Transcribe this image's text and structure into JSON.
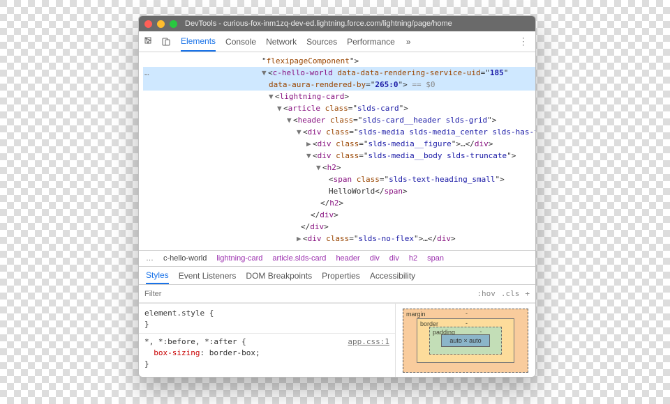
{
  "title": "DevTools - curious-fox-inm1zq-dev-ed.lightning.force.com/lightning/page/home",
  "tabs": [
    "Elements",
    "Console",
    "Network",
    "Sources",
    "Performance"
  ],
  "tabs_more": "»",
  "breadcrumbs": {
    "ell": "…",
    "cur": "c-hello-world",
    "items": [
      "lightning-card",
      "article.slds-card",
      "header",
      "div",
      "div",
      "h2",
      "span"
    ]
  },
  "subtabs": [
    "Styles",
    "Event Listeners",
    "DOM Breakpoints",
    "Properties",
    "Accessibility"
  ],
  "filter": {
    "placeholder": "Filter",
    "hov": ":hov",
    "cls": ".cls",
    "plus": "+"
  },
  "dom": {
    "l0": "flexipageComponent",
    "l1a": "c-hello-world",
    "l1b": "data-data-rendering-service-uid",
    "l1c": "185",
    "l1d": "data-aura-rendered-by",
    "l1e": "265:0",
    "l1f": "== $0",
    "l2": "lightning-card",
    "l3a": "article",
    "l3b": "slds-card",
    "l4a": "header",
    "l4b": "slds-card__header slds-grid",
    "l5a": "div",
    "l5b": "slds-media slds-media_center slds-has-flexi-truncate",
    "l6a": "div",
    "l6b": "slds-media__figure",
    "l7a": "div",
    "l7b": "slds-media__body slds-truncate",
    "l8": "h2",
    "l9a": "span",
    "l9b": "slds-text-heading_small",
    "l10": "HelloWorld",
    "l10b": "span",
    "l11": "h2",
    "l12": "div",
    "l13": "div",
    "l14a": "div",
    "l14b": "slds-no-flex",
    "l14c": "div"
  },
  "styles": {
    "es": "element.style {",
    "close": "}",
    "sel": "*, *:before, *:after {",
    "src": "app.css:1",
    "prop": "box-sizing",
    "val": "border-box;"
  },
  "box": {
    "margin": "margin",
    "border": "border",
    "padding": "padding",
    "content": "auto × auto",
    "dash": "-"
  }
}
